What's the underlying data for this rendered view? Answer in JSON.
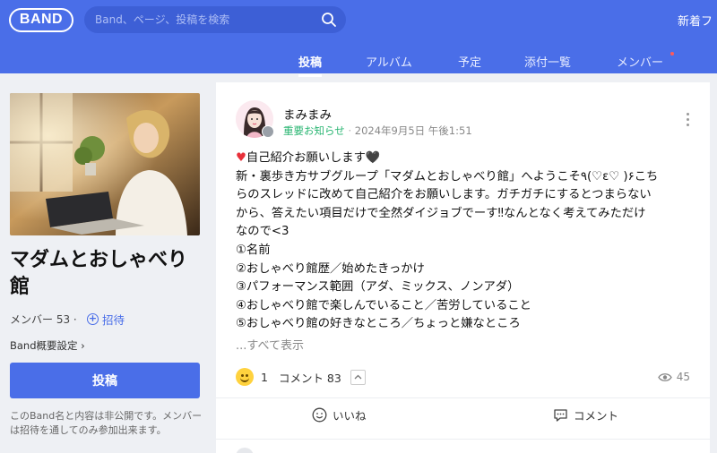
{
  "header": {
    "logo": "BAND",
    "search_placeholder": "Band、ページ、投稿を検索",
    "news_label": "新着フ"
  },
  "tabs": [
    {
      "label": "投稿",
      "active": true
    },
    {
      "label": "アルバム"
    },
    {
      "label": "予定"
    },
    {
      "label": "添付一覧"
    },
    {
      "label": "メンバー"
    }
  ],
  "sidebar": {
    "band_name": "マダムとおしゃべり館",
    "members": "メンバー 53 ·",
    "invite": "招待",
    "settings": "Band概要設定 ›",
    "post_button": "投稿",
    "private_note": "このBand名と内容は非公開です。メンバーは招待を通してのみ参加出来ます。"
  },
  "post": {
    "author": "まみまみ",
    "notice": "重要お知らせ",
    "separator": "·",
    "date": "2024年9月5日 午後1:51",
    "lines": [
      "♥自己紹介お願いします🖤",
      "新・裏歩き方サブグループ「マダムとおしゃべり館」へようこそ٩(♡ε♡ )۶こち",
      "らのスレッドに改めて自己紹介をお願いします。ガチガチにするとつまらない",
      "から、答えたい項目だけで全然ダイジョブでーす‼なんとなく考えてみただけ",
      "なので<3",
      "①名前",
      "②おしゃべり館歴／始めたきっかけ",
      "③パフォーマンス範囲（アダ、ミックス、ノンアダ）",
      "④おしゃべり館で楽しんでいること／苦労していること",
      "⑤おしゃべり館の好きなところ／ちょっと嫌なところ"
    ],
    "see_all": "...すべて表示",
    "reaction_count": "1",
    "comment_label": "コメント 83",
    "views": "45",
    "like_label": "いいね",
    "comment_button": "コメント"
  },
  "colors": {
    "brand": "#4a6ee8",
    "notice": "#2bb673",
    "heart": "#e8303a"
  }
}
